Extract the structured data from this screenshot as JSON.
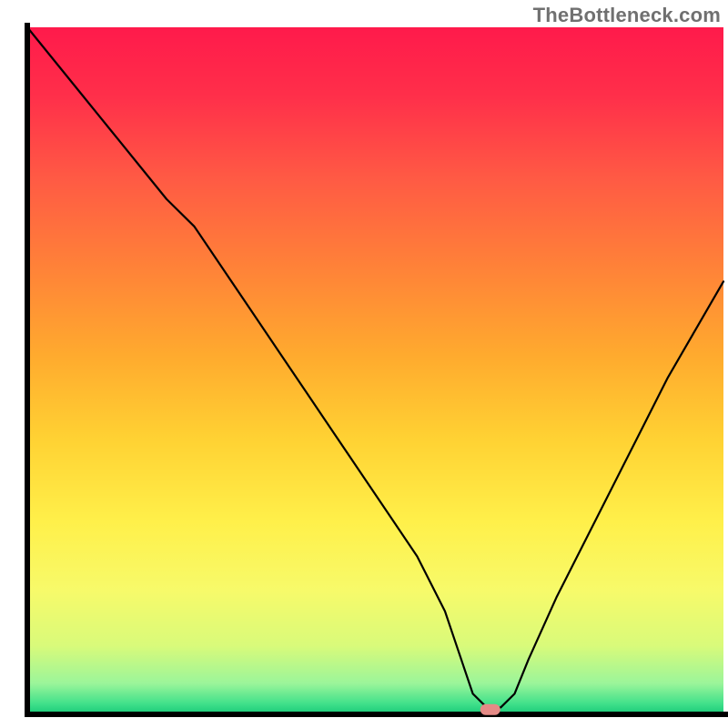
{
  "watermark": "TheBottleneck.com",
  "chart_data": {
    "type": "line",
    "title": "",
    "xlabel": "",
    "ylabel": "",
    "xlim": [
      0,
      100
    ],
    "ylim": [
      0,
      100
    ],
    "x": [
      0,
      4,
      8,
      12,
      16,
      20,
      24,
      28,
      32,
      36,
      40,
      44,
      48,
      52,
      56,
      60,
      62,
      64,
      66,
      68,
      70,
      72,
      76,
      80,
      84,
      88,
      92,
      96,
      100
    ],
    "values": [
      100,
      95,
      90,
      85,
      80,
      75,
      71,
      65,
      59,
      53,
      47,
      41,
      35,
      29,
      23,
      15,
      9,
      3,
      1,
      1,
      3,
      8,
      17,
      25,
      33,
      41,
      49,
      56,
      63
    ],
    "marker": {
      "x": 66.5,
      "y": 0.7
    },
    "gradient_stops": [
      {
        "offset": 0.0,
        "color": "#ff1a4b"
      },
      {
        "offset": 0.1,
        "color": "#ff2f4a"
      },
      {
        "offset": 0.22,
        "color": "#ff5a44"
      },
      {
        "offset": 0.35,
        "color": "#ff8238"
      },
      {
        "offset": 0.48,
        "color": "#ffab2e"
      },
      {
        "offset": 0.6,
        "color": "#ffd233"
      },
      {
        "offset": 0.72,
        "color": "#fff04a"
      },
      {
        "offset": 0.82,
        "color": "#f7fa6a"
      },
      {
        "offset": 0.9,
        "color": "#d9fa7a"
      },
      {
        "offset": 0.955,
        "color": "#9bf59a"
      },
      {
        "offset": 0.985,
        "color": "#3fe08a"
      },
      {
        "offset": 1.0,
        "color": "#18c878"
      }
    ],
    "axis_color": "#000000",
    "line_color": "#000000",
    "marker_color": "#e58a86"
  }
}
